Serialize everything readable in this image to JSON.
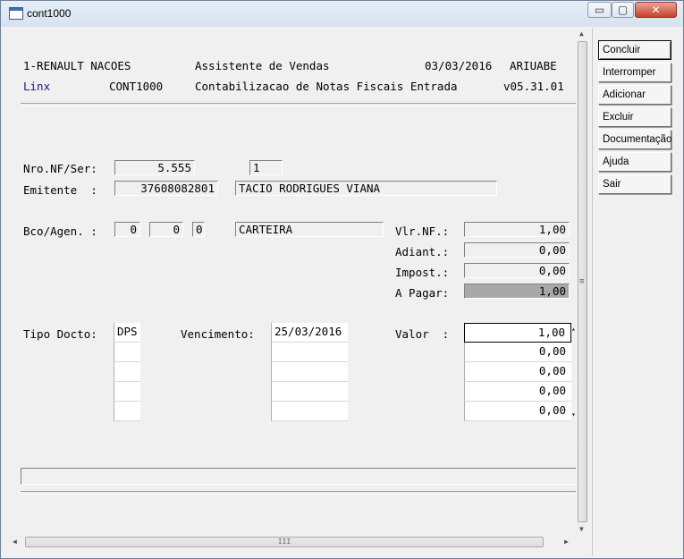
{
  "window": {
    "title": "cont1000",
    "controls": {
      "minimize": "▭",
      "maximize": "▢",
      "close": "✕"
    }
  },
  "header": {
    "company": "1-RENAULT NACOES",
    "module": "Assistente de Vendas",
    "date": "03/03/2016",
    "user": "ARIUABE",
    "brand": "Linx",
    "program": "CONT1000",
    "description": "Contabilizacao de Notas Fiscais Entrada",
    "version": "v05.31.01"
  },
  "form": {
    "nf_label": "Nro.NF/Ser:",
    "nf_number": "5.555",
    "nf_series": "1",
    "emitente_label": "Emitente  :",
    "emitente_code": "37608082801",
    "emitente_name": "TACIO RODRIGUES VIANA",
    "bco_label": "Bco/Agen. :",
    "bco": "0",
    "agencia": "0",
    "agencia_dv": "0",
    "carteira": "CARTEIRA",
    "vlr_nf_label": "Vlr.NF.:",
    "vlr_nf": "1,00",
    "adiant_label": "Adiant.:",
    "adiant": "0,00",
    "impost_label": "Impost.:",
    "impost": "0,00",
    "a_pagar_label": "A Pagar:",
    "a_pagar": "1,00",
    "tipo_docto_label": "Tipo Docto:",
    "vencimento_label": "Vencimento:",
    "valor_label": "Valor  :"
  },
  "installments": [
    {
      "tipo": "DPS",
      "vencimento": "25/03/2016",
      "valor": "1,00"
    },
    {
      "tipo": "",
      "vencimento": "",
      "valor": "0,00"
    },
    {
      "tipo": "",
      "vencimento": "",
      "valor": "0,00"
    },
    {
      "tipo": "",
      "vencimento": "",
      "valor": "0,00"
    },
    {
      "tipo": "",
      "vencimento": "",
      "valor": "0,00"
    }
  ],
  "actions": {
    "concluir": "Concluir",
    "interromper": "Interromper",
    "adicionar": "Adicionar",
    "excluir": "Excluir",
    "documentacao": "Documentação",
    "ajuda": "Ajuda",
    "sair": "Sair"
  },
  "scrollbar": {
    "hthumb_grip": "III",
    "vthumb_grip": "≡"
  }
}
